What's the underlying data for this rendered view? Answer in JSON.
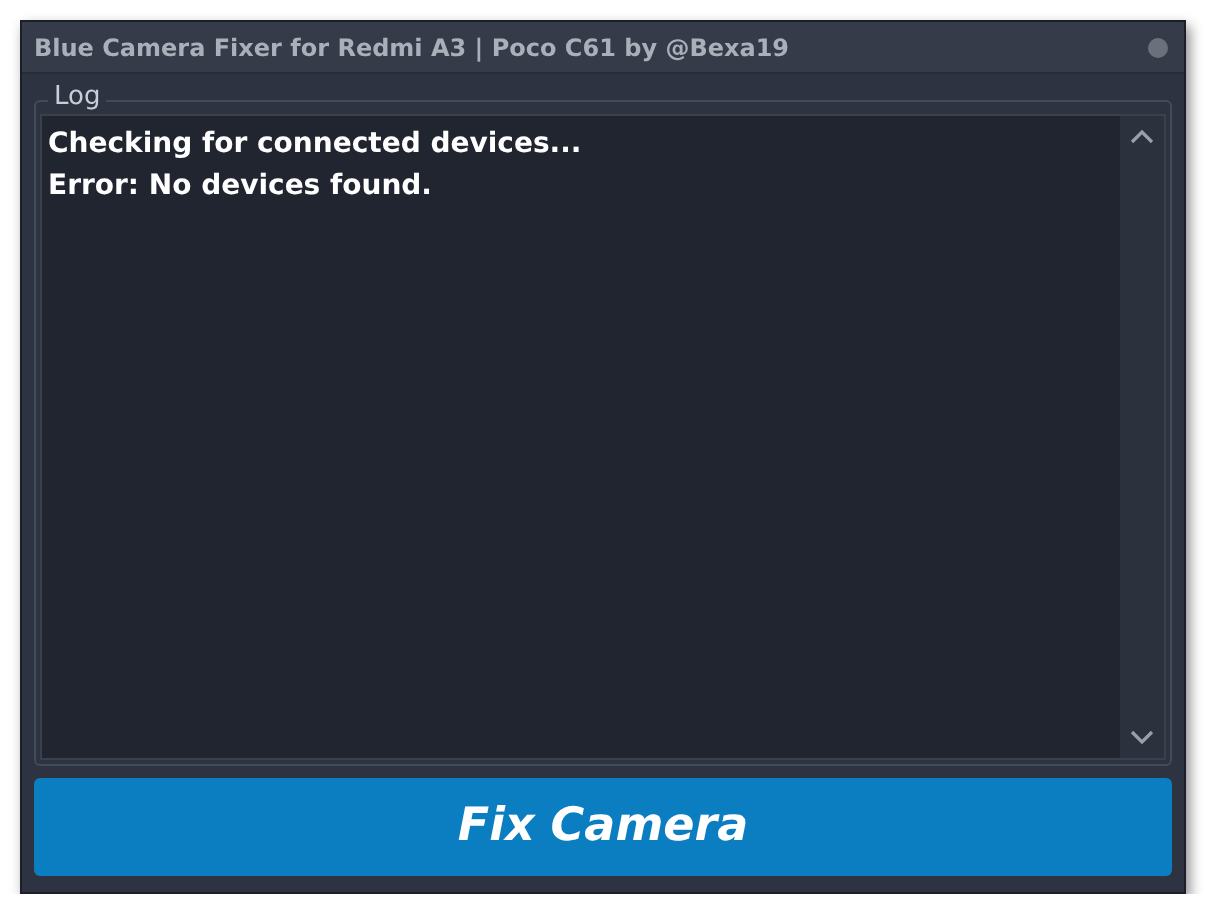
{
  "window": {
    "title": "Blue Camera Fixer for Redmi A3 | Poco C61 by @Bexa19"
  },
  "log": {
    "label": "Log",
    "lines": [
      "Checking for connected devices...",
      "Error: No devices found."
    ]
  },
  "buttons": [
    {
      "label": "Fix Camera"
    }
  ]
}
